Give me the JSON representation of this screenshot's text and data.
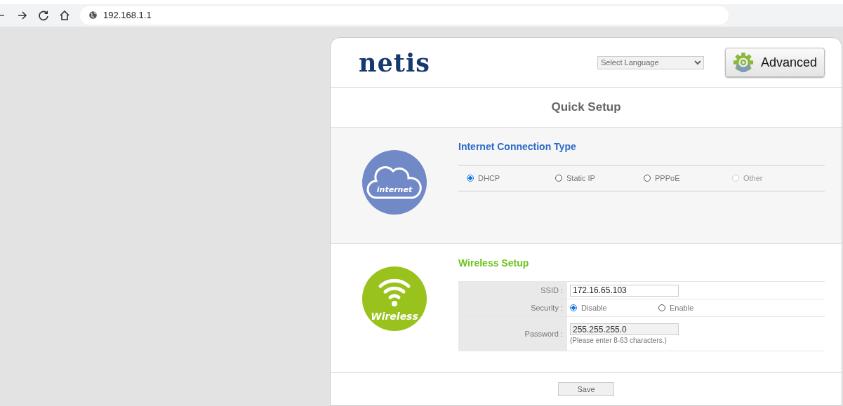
{
  "browser": {
    "address": "192.168.1.1"
  },
  "header": {
    "logo": "netis",
    "language_select": "Select Language",
    "advanced_button": "Advanced"
  },
  "title": "Quick Setup",
  "internet": {
    "icon_label": "internet",
    "heading": "Internet Connection Type",
    "options": [
      {
        "label": "DHCP",
        "selected": true,
        "disabled": false
      },
      {
        "label": "Static IP",
        "selected": false,
        "disabled": false
      },
      {
        "label": "PPPoE",
        "selected": false,
        "disabled": false
      },
      {
        "label": "Other",
        "selected": false,
        "disabled": true
      }
    ]
  },
  "wireless": {
    "icon_label": "Wireless",
    "heading": "Wireless Setup",
    "ssid": {
      "label": "SSID :",
      "value": "172.16.65.103"
    },
    "security": {
      "label": "Security :",
      "options": [
        {
          "label": "Disable",
          "selected": true
        },
        {
          "label": "Enable",
          "selected": false
        }
      ]
    },
    "password": {
      "label": "Password :",
      "value": "255.255.255.0",
      "disabled": true,
      "hint": "(Please enter 8-63 characters.)"
    }
  },
  "save_button": "Save"
}
